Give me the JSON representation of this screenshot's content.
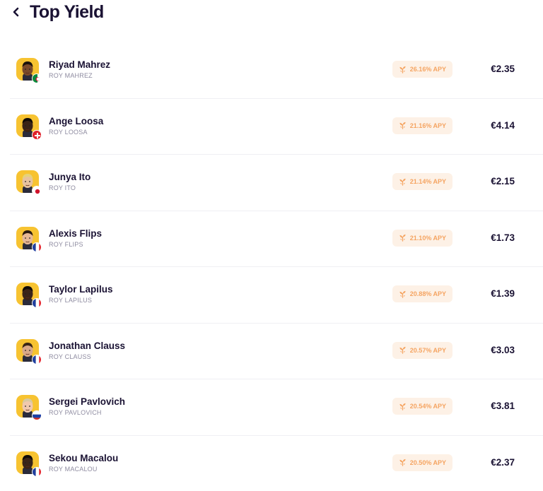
{
  "header": {
    "title": "Top Yield"
  },
  "players": [
    {
      "name": "Riyad Mahrez",
      "ticker": "ROY MAHREZ",
      "apy": "26.16% APY",
      "price": "€2.35",
      "flag": "algeria",
      "skin": "#7a4a2a",
      "hair": "#1a120c"
    },
    {
      "name": "Ange Loosa",
      "ticker": "ROY LOOSA",
      "apy": "21.16% APY",
      "price": "€4.14",
      "flag": "switzerland",
      "skin": "#3b2416",
      "hair": "#0f0a06"
    },
    {
      "name": "Junya Ito",
      "ticker": "ROY ITO",
      "apy": "21.14% APY",
      "price": "€2.15",
      "flag": "japan",
      "skin": "#e8c39e",
      "hair": "#e6d27a"
    },
    {
      "name": "Alexis Flips",
      "ticker": "ROY FLIPS",
      "apy": "21.10% APY",
      "price": "€1.73",
      "flag": "france",
      "skin": "#e6b896",
      "hair": "#2a1a10"
    },
    {
      "name": "Taylor Lapilus",
      "ticker": "ROY LAPILUS",
      "apy": "20.88% APY",
      "price": "€1.39",
      "flag": "france",
      "skin": "#3a2418",
      "hair": "#0f0a06"
    },
    {
      "name": "Jonathan Clauss",
      "ticker": "ROY CLAUSS",
      "apy": "20.57% APY",
      "price": "€3.03",
      "flag": "france",
      "skin": "#d9a888",
      "hair": "#3a2616"
    },
    {
      "name": "Sergei Pavlovich",
      "ticker": "ROY PAVLOVICH",
      "apy": "20.54% APY",
      "price": "€3.81",
      "flag": "russia",
      "skin": "#f0c8ae",
      "hair": "#d8c9a0"
    },
    {
      "name": "Sekou Macalou",
      "ticker": "ROY MACALOU",
      "apy": "20.50% APY",
      "price": "€2.37",
      "flag": "france",
      "skin": "#3a2418",
      "hair": "#0f0a06"
    }
  ],
  "colors": {
    "accent": "#f5a461",
    "apy_bg": "#fdf1e6",
    "avatar_bg": "#f7c331",
    "text": "#1a1233",
    "muted": "#8e8ba0"
  },
  "icons": {
    "back": "chevron-left-icon",
    "apy": "sprout-icon"
  }
}
